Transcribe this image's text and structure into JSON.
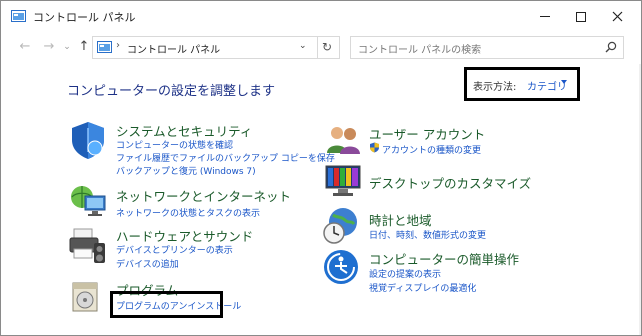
{
  "window": {
    "title": "コントロール パネル"
  },
  "nav": {
    "address_text": "コントロール パネル",
    "search_placeholder": "コントロール パネルの検索"
  },
  "main": {
    "heading": "コンピューターの設定を調整します",
    "view_by_label": "表示方法:",
    "view_by_value": "カテゴリ"
  },
  "categories": {
    "system": {
      "title": "システムとセキュリティ",
      "links": [
        "コンピューターの状態を確認",
        "ファイル履歴でファイルのバックアップ コピーを保存",
        "バックアップと復元 (Windows 7)"
      ]
    },
    "network": {
      "title": "ネットワークとインターネット",
      "links": [
        "ネットワークの状態とタスクの表示"
      ]
    },
    "hardware": {
      "title": "ハードウェアとサウンド",
      "links": [
        "デバイスとプリンターの表示",
        "デバイスの追加"
      ]
    },
    "programs": {
      "title": "プログラム",
      "links": [
        "プログラムのアンインストール"
      ]
    },
    "user": {
      "title": "ユーザー アカウント",
      "links": [
        "アカウントの種類の変更"
      ]
    },
    "desktop": {
      "title": "デスクトップのカスタマイズ"
    },
    "clock": {
      "title": "時計と地域",
      "links": [
        "日付、時刻、数値形式の変更"
      ]
    },
    "ease": {
      "title": "コンピューターの簡単操作",
      "links": [
        "設定の提案の表示",
        "視覚ディスプレイの最適化"
      ]
    }
  }
}
